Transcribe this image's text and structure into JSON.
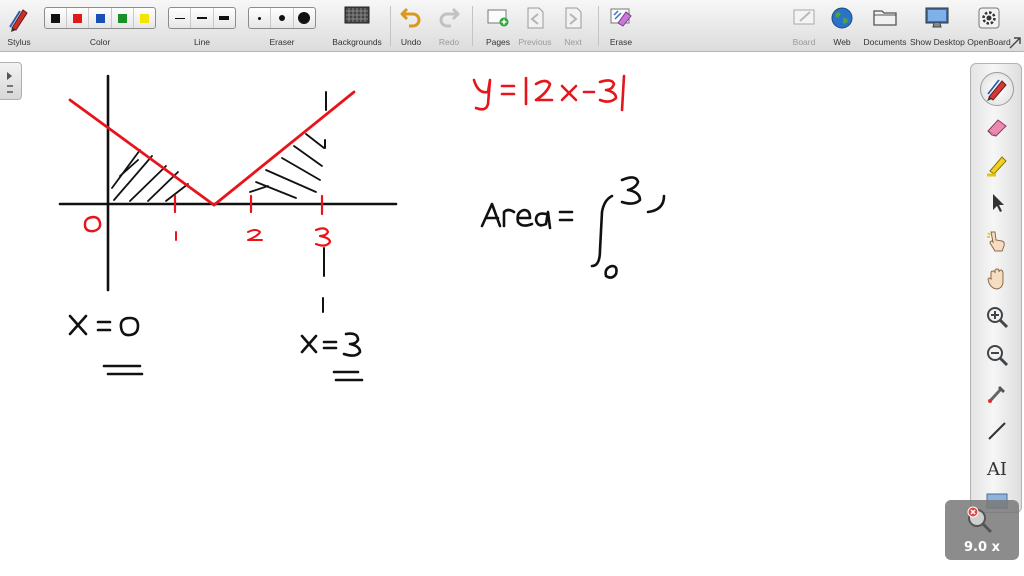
{
  "toolbar": {
    "stylus_label": "Stylus",
    "color_label": "Color",
    "line_label": "Line",
    "eraser_label": "Eraser",
    "backgrounds_label": "Backgrounds",
    "undo_label": "Undo",
    "redo_label": "Redo",
    "pages_label": "Pages",
    "previous_label": "Previous",
    "next_label": "Next",
    "erase_label": "Erase",
    "board_label": "Board",
    "web_label": "Web",
    "documents_label": "Documents",
    "show_desktop_label": "Show Desktop",
    "openboard_label": "OpenBoard",
    "colors": [
      "#111111",
      "#e01a1a",
      "#1a4fb5",
      "#1a8f2a",
      "#f2e600"
    ]
  },
  "canvas": {
    "ink_black": "#111111",
    "ink_red": "#e8141b",
    "origin_label": "0",
    "tick_1": "1",
    "tick_2": "2",
    "tick_3": "3",
    "equation": "y = |2x-3|",
    "area_text": "Area =",
    "upper_limit": "3",
    "lower_limit": "0",
    "x_eq_0": "x = 0",
    "x_eq_3": "x = 3"
  },
  "palette": {
    "text_tool_label": "AI"
  },
  "zoom": {
    "level": "9.0 x"
  }
}
